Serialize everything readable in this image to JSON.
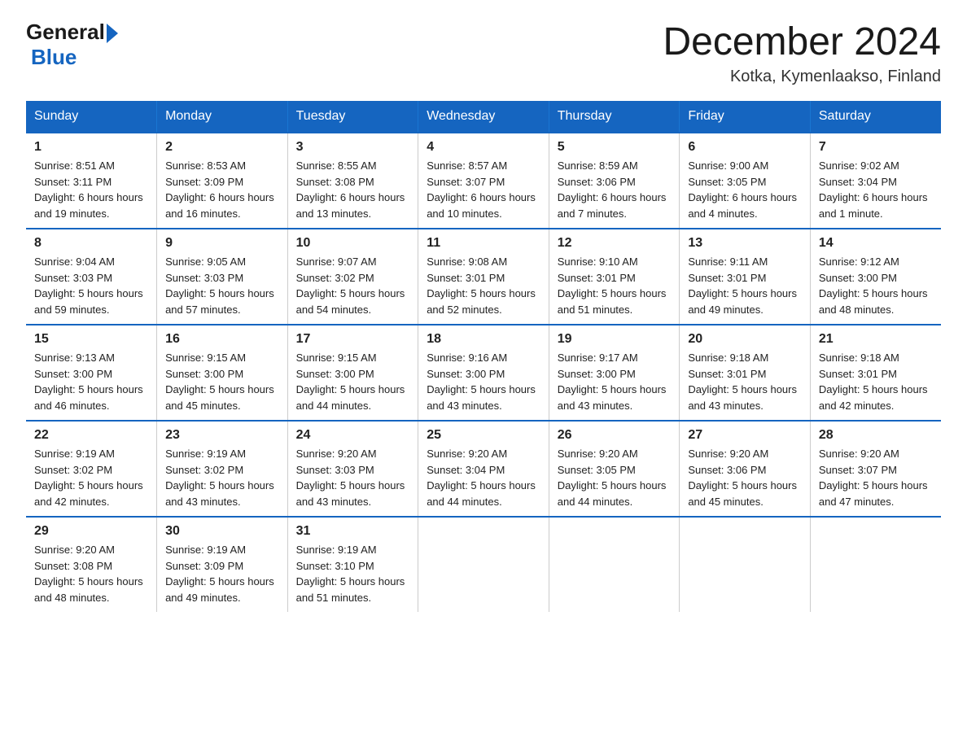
{
  "header": {
    "logo_general": "General",
    "logo_blue": "Blue",
    "month_title": "December 2024",
    "location": "Kotka, Kymenlaakso, Finland"
  },
  "days_of_week": [
    "Sunday",
    "Monday",
    "Tuesday",
    "Wednesday",
    "Thursday",
    "Friday",
    "Saturday"
  ],
  "weeks": [
    [
      {
        "day": "1",
        "sunrise": "8:51 AM",
        "sunset": "3:11 PM",
        "daylight": "6 hours and 19 minutes."
      },
      {
        "day": "2",
        "sunrise": "8:53 AM",
        "sunset": "3:09 PM",
        "daylight": "6 hours and 16 minutes."
      },
      {
        "day": "3",
        "sunrise": "8:55 AM",
        "sunset": "3:08 PM",
        "daylight": "6 hours and 13 minutes."
      },
      {
        "day": "4",
        "sunrise": "8:57 AM",
        "sunset": "3:07 PM",
        "daylight": "6 hours and 10 minutes."
      },
      {
        "day": "5",
        "sunrise": "8:59 AM",
        "sunset": "3:06 PM",
        "daylight": "6 hours and 7 minutes."
      },
      {
        "day": "6",
        "sunrise": "9:00 AM",
        "sunset": "3:05 PM",
        "daylight": "6 hours and 4 minutes."
      },
      {
        "day": "7",
        "sunrise": "9:02 AM",
        "sunset": "3:04 PM",
        "daylight": "6 hours and 1 minute."
      }
    ],
    [
      {
        "day": "8",
        "sunrise": "9:04 AM",
        "sunset": "3:03 PM",
        "daylight": "5 hours and 59 minutes."
      },
      {
        "day": "9",
        "sunrise": "9:05 AM",
        "sunset": "3:03 PM",
        "daylight": "5 hours and 57 minutes."
      },
      {
        "day": "10",
        "sunrise": "9:07 AM",
        "sunset": "3:02 PM",
        "daylight": "5 hours and 54 minutes."
      },
      {
        "day": "11",
        "sunrise": "9:08 AM",
        "sunset": "3:01 PM",
        "daylight": "5 hours and 52 minutes."
      },
      {
        "day": "12",
        "sunrise": "9:10 AM",
        "sunset": "3:01 PM",
        "daylight": "5 hours and 51 minutes."
      },
      {
        "day": "13",
        "sunrise": "9:11 AM",
        "sunset": "3:01 PM",
        "daylight": "5 hours and 49 minutes."
      },
      {
        "day": "14",
        "sunrise": "9:12 AM",
        "sunset": "3:00 PM",
        "daylight": "5 hours and 48 minutes."
      }
    ],
    [
      {
        "day": "15",
        "sunrise": "9:13 AM",
        "sunset": "3:00 PM",
        "daylight": "5 hours and 46 minutes."
      },
      {
        "day": "16",
        "sunrise": "9:15 AM",
        "sunset": "3:00 PM",
        "daylight": "5 hours and 45 minutes."
      },
      {
        "day": "17",
        "sunrise": "9:15 AM",
        "sunset": "3:00 PM",
        "daylight": "5 hours and 44 minutes."
      },
      {
        "day": "18",
        "sunrise": "9:16 AM",
        "sunset": "3:00 PM",
        "daylight": "5 hours and 43 minutes."
      },
      {
        "day": "19",
        "sunrise": "9:17 AM",
        "sunset": "3:00 PM",
        "daylight": "5 hours and 43 minutes."
      },
      {
        "day": "20",
        "sunrise": "9:18 AM",
        "sunset": "3:01 PM",
        "daylight": "5 hours and 43 minutes."
      },
      {
        "day": "21",
        "sunrise": "9:18 AM",
        "sunset": "3:01 PM",
        "daylight": "5 hours and 42 minutes."
      }
    ],
    [
      {
        "day": "22",
        "sunrise": "9:19 AM",
        "sunset": "3:02 PM",
        "daylight": "5 hours and 42 minutes."
      },
      {
        "day": "23",
        "sunrise": "9:19 AM",
        "sunset": "3:02 PM",
        "daylight": "5 hours and 43 minutes."
      },
      {
        "day": "24",
        "sunrise": "9:20 AM",
        "sunset": "3:03 PM",
        "daylight": "5 hours and 43 minutes."
      },
      {
        "day": "25",
        "sunrise": "9:20 AM",
        "sunset": "3:04 PM",
        "daylight": "5 hours and 44 minutes."
      },
      {
        "day": "26",
        "sunrise": "9:20 AM",
        "sunset": "3:05 PM",
        "daylight": "5 hours and 44 minutes."
      },
      {
        "day": "27",
        "sunrise": "9:20 AM",
        "sunset": "3:06 PM",
        "daylight": "5 hours and 45 minutes."
      },
      {
        "day": "28",
        "sunrise": "9:20 AM",
        "sunset": "3:07 PM",
        "daylight": "5 hours and 47 minutes."
      }
    ],
    [
      {
        "day": "29",
        "sunrise": "9:20 AM",
        "sunset": "3:08 PM",
        "daylight": "5 hours and 48 minutes."
      },
      {
        "day": "30",
        "sunrise": "9:19 AM",
        "sunset": "3:09 PM",
        "daylight": "5 hours and 49 minutes."
      },
      {
        "day": "31",
        "sunrise": "9:19 AM",
        "sunset": "3:10 PM",
        "daylight": "5 hours and 51 minutes."
      },
      null,
      null,
      null,
      null
    ]
  ],
  "labels": {
    "sunrise": "Sunrise:",
    "sunset": "Sunset:",
    "daylight": "Daylight:"
  }
}
